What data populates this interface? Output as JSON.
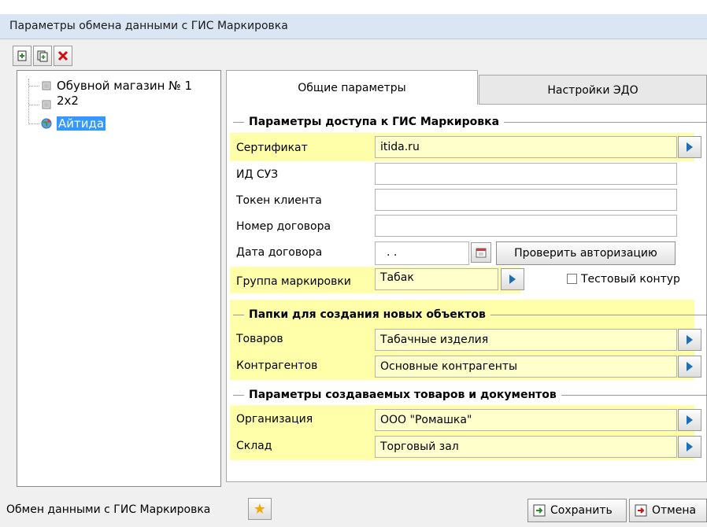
{
  "window": {
    "title": "Параметры обмена данными с ГИС Маркировка"
  },
  "toolbar": {
    "add_icon": "add-icon",
    "copy_icon": "copy-icon",
    "delete_icon": "delete-icon"
  },
  "tree": {
    "items": [
      {
        "label": "Обувной магазин № 1",
        "icon": "store-icon",
        "selected": false
      },
      {
        "label": "2x2",
        "icon": "store-icon",
        "selected": false
      },
      {
        "label": "Айтида",
        "icon": "globe-icon",
        "selected": true
      }
    ]
  },
  "tabs": [
    {
      "label": "Общие параметры",
      "active": true
    },
    {
      "label": "Настройки ЭДО",
      "active": false
    }
  ],
  "access": {
    "section_title": "Параметры доступа к ГИС Маркировка",
    "certificate_label": "Сертификат",
    "certificate_value": "itida.ru",
    "suz_label": "ИД СУЗ",
    "suz_value": "",
    "token_label": "Токен клиента",
    "token_value": "",
    "contract_number_label": "Номер договора",
    "contract_number_value": "",
    "contract_date_label": "Дата договора",
    "contract_date_value": " .  .",
    "check_auth_label": "Проверить авторизацию",
    "group_label": "Группа маркировки",
    "group_value": "Табак",
    "test_contour_label": "Тестовый контур",
    "test_contour_checked": false
  },
  "folders": {
    "section_title": "Папки для создания новых объектов",
    "goods_label": "Товаров",
    "goods_value": "Табачные изделия",
    "contractors_label": "Контрагентов",
    "contractors_value": "Основные контрагенты"
  },
  "created": {
    "section_title": "Параметры создаваемых товаров и документов",
    "org_label": "Организация",
    "org_value": "ООО \"Ромашка\"",
    "warehouse_label": "Склад",
    "warehouse_value": "Торговый зал"
  },
  "footer": {
    "label": "Обмен данными с ГИС Маркировка",
    "save_label": "Сохранить",
    "cancel_label": "Отмена"
  },
  "colors": {
    "highlight": "#ffffaa",
    "selection": "#3399ff",
    "titlebar": "#dbe6f4"
  }
}
